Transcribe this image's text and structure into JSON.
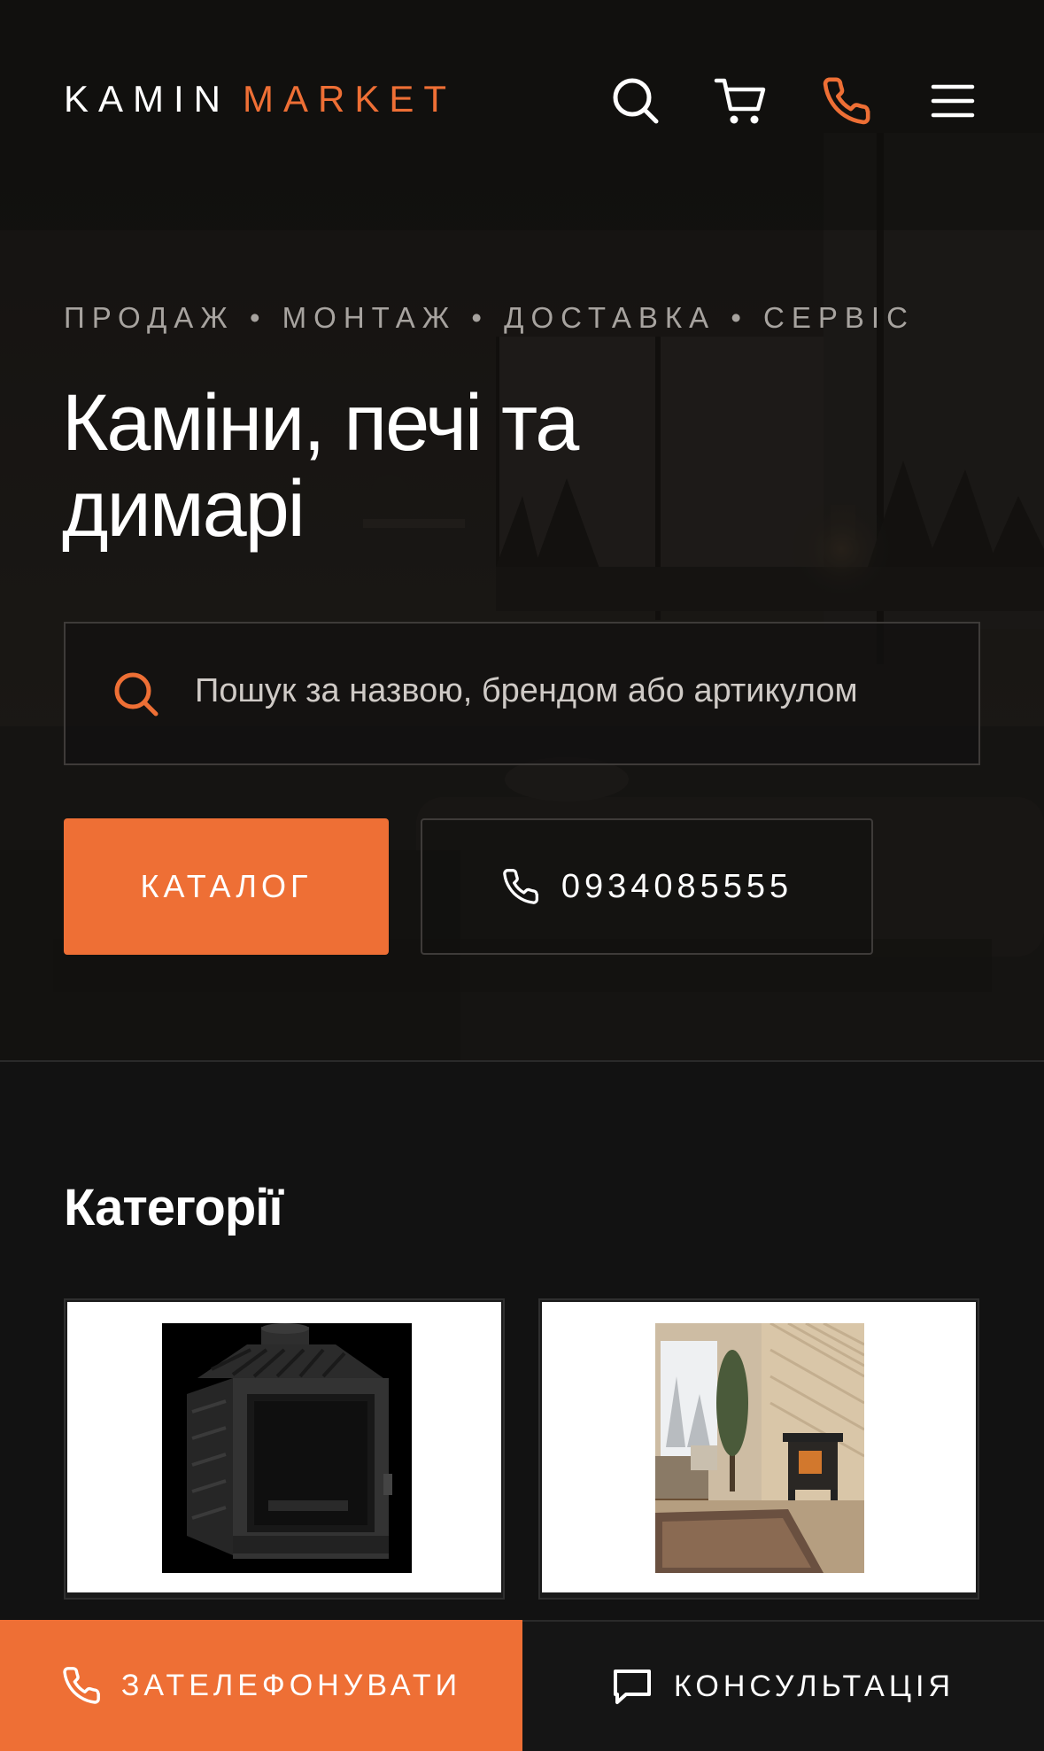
{
  "header": {
    "logo_word1": "KAMIN",
    "logo_word2": "MARKET",
    "icons": [
      "search-icon",
      "cart-icon",
      "phone-icon",
      "menu-icon"
    ]
  },
  "hero": {
    "tagline": "ПРОДАЖ • МОНТАЖ • ДОСТАВКА • СЕРВІС",
    "headline": "Каміни, печі та димарі",
    "search_placeholder": "Пошук за назвою, брендом або артикулом",
    "catalog_button": "КАТАЛОГ",
    "phone_number": "0934085555"
  },
  "categories": {
    "title": "Категорії",
    "items": [
      {
        "image": "fireplace-insert-image"
      },
      {
        "image": "wood-stove-room-image"
      }
    ]
  },
  "bottom_bar": {
    "call_label": "ЗАТЕЛЕФОНУВАТИ",
    "consult_label": "КОНСУЛЬТАЦІЯ"
  },
  "colors": {
    "accent": "#ee6f35",
    "background": "#121212",
    "hero_text_muted": "#a7a39f"
  }
}
